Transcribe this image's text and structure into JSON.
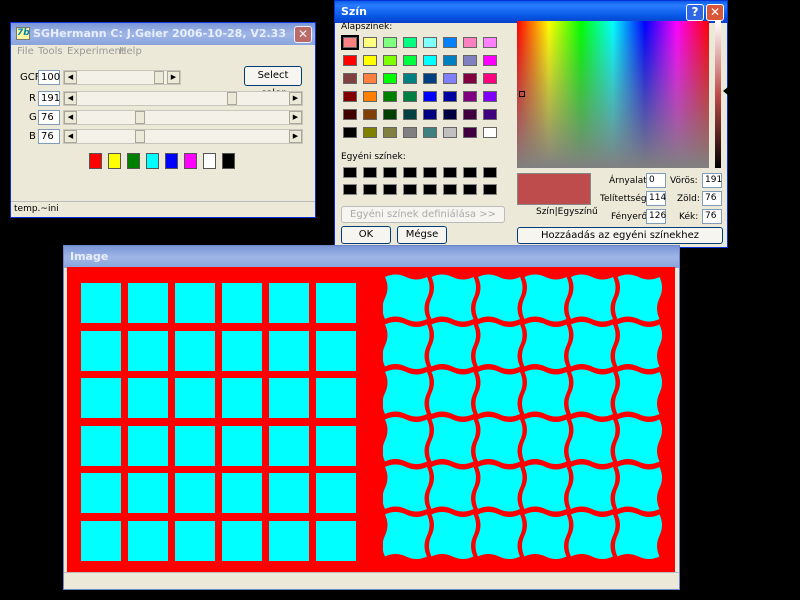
{
  "sghermann": {
    "title": "SGHermann C: J.Geier 2006-10-28, V2.33",
    "icon_text": "7b",
    "menu": [
      "File",
      "Tools",
      "Experiment",
      "Help"
    ],
    "rows": [
      {
        "label": "GCF",
        "value": "100",
        "level": 1.0
      },
      {
        "label": "R",
        "value": "191",
        "level": 0.75
      },
      {
        "label": "G",
        "value": "76",
        "level": 0.3
      },
      {
        "label": "B",
        "value": "76",
        "level": 0.3
      }
    ],
    "select_button": "Select color",
    "swatches": [
      "#ff0000",
      "#ffff00",
      "#008000",
      "#00ffff",
      "#0000ff",
      "#ff00ff",
      "#ffffff",
      "#000000"
    ],
    "status": "temp.~ini",
    "close_icon": "close-icon"
  },
  "szin": {
    "title": "Szín",
    "basic_label": "Alapszínek:",
    "custom_label": "Egyéni színek:",
    "define_button": "Egyéni színek definiálása >>",
    "ok_button": "OK",
    "cancel_button": "Mégse",
    "add_button": "Hozzáadás az egyéni színekhez",
    "preview_label": "Szín|Egyszínű",
    "preview_color": "#bf4c4c",
    "hue_label": "Árnyalat:",
    "hue": "0",
    "sat_label": "Telítettség:",
    "sat": "114",
    "lum_label": "Fényerő:",
    "lum": "126",
    "red_label": "Vörös:",
    "red": "191",
    "green_label": "Zöld:",
    "green": "76",
    "blue_label": "Kék:",
    "blue": "76",
    "help_icon": "?",
    "basic_colors": [
      [
        "#ff8080",
        "#ffff80",
        "#80ff80",
        "#00ff80",
        "#80ffff",
        "#0080ff",
        "#ff80c0",
        "#ff80ff"
      ],
      [
        "#ff0000",
        "#ffff00",
        "#80ff00",
        "#00ff40",
        "#00ffff",
        "#0080c0",
        "#8080c0",
        "#ff00ff"
      ],
      [
        "#804040",
        "#ff8040",
        "#00ff00",
        "#008080",
        "#004080",
        "#8080ff",
        "#800040",
        "#ff0080"
      ],
      [
        "#800000",
        "#ff8000",
        "#008000",
        "#008040",
        "#0000ff",
        "#0000a0",
        "#800080",
        "#8000ff"
      ],
      [
        "#400000",
        "#804000",
        "#004000",
        "#004040",
        "#000080",
        "#000040",
        "#400040",
        "#400080"
      ],
      [
        "#000000",
        "#808000",
        "#808040",
        "#808080",
        "#408080",
        "#c0c0c0",
        "#400040",
        "#ffffff"
      ]
    ]
  },
  "image_window": {
    "title": "Image",
    "background": "#ff0000",
    "square_color": "#00ffff",
    "rows": 6,
    "cols": 6
  }
}
